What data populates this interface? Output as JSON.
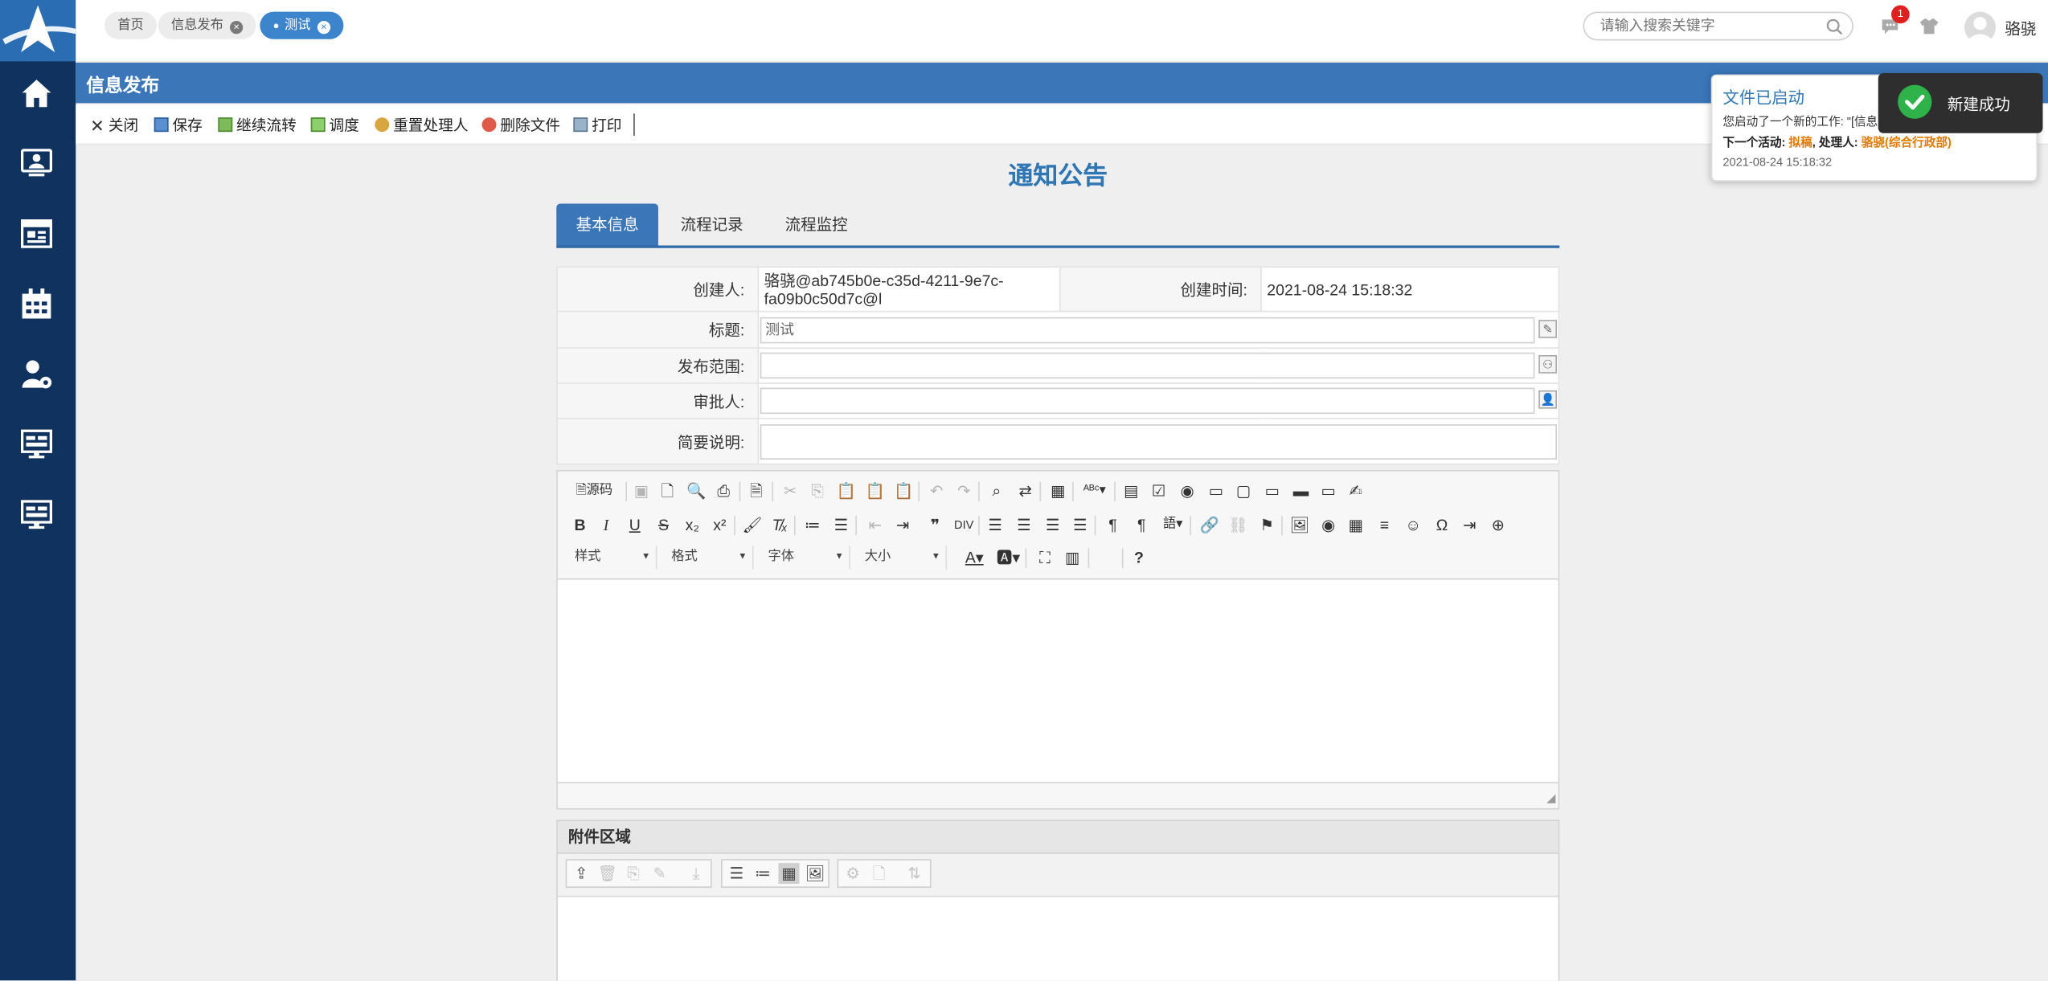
{
  "colors": {
    "sidebar": "#10325f",
    "accent": "#3a76b8",
    "title": "#2f76b5",
    "badge": "#e02020",
    "success": "#2fb24a",
    "warn_text": "#e07b00"
  },
  "sidebar": {
    "items": [
      {
        "icon": "home-icon"
      },
      {
        "icon": "monitor-user-icon"
      },
      {
        "icon": "news-icon"
      },
      {
        "icon": "calendar-icon"
      },
      {
        "icon": "user-settings-icon"
      },
      {
        "icon": "dashboard-icon"
      },
      {
        "icon": "dashboard-icon"
      }
    ]
  },
  "topbar": {
    "tabs": [
      {
        "label": "首页",
        "closable": false
      },
      {
        "label": "信息发布",
        "closable": true
      },
      {
        "label": "测试",
        "closable": true,
        "active": true
      }
    ],
    "search_placeholder": "请输入搜索关键字",
    "notify_count": "1",
    "username": "骆骁"
  },
  "module_title": "信息发布",
  "actions": [
    {
      "label": "关闭",
      "icon": "close-icon"
    },
    {
      "label": "保存",
      "icon": "save-icon"
    },
    {
      "label": "继续流转",
      "icon": "forward-icon"
    },
    {
      "label": "调度",
      "icon": "dispatch-icon"
    },
    {
      "label": "重置处理人",
      "icon": "reset-user-icon"
    },
    {
      "label": "删除文件",
      "icon": "delete-icon"
    },
    {
      "label": "打印",
      "icon": "print-icon"
    }
  ],
  "doc_title": "通知公告",
  "doc_tabs": [
    {
      "label": "基本信息",
      "active": true
    },
    {
      "label": "流程记录"
    },
    {
      "label": "流程监控"
    }
  ],
  "form": {
    "creator_label": "创建人:",
    "creator_value": "骆骁@ab745b0e-c35d-4211-9e7c-fa09b0c50d7c@l",
    "created_label": "创建时间:",
    "created_value": "2021-08-24 15:18:32",
    "title_label": "标题:",
    "title_value": "测试",
    "scope_label": "发布范围:",
    "scope_value": "",
    "approver_label": "审批人:",
    "approver_value": "",
    "summary_label": "简要说明:",
    "summary_value": ""
  },
  "editor": {
    "source_label": "源码",
    "style_label": "样式",
    "format_label": "格式",
    "font_label": "字体",
    "size_label": "大小"
  },
  "attachments": {
    "title": "附件区域"
  },
  "popup": {
    "title": "文件已启动",
    "line1": "您启动了一个新的工作: \"[信息发布]测试\"",
    "next_label": "下一个活动:",
    "next_value": "拟稿",
    "handler_label": "处理人:",
    "handler_value": "骆骁(综合行政部)",
    "time": "2021-08-24 15:18:32"
  },
  "toast": {
    "text": "新建成功"
  }
}
